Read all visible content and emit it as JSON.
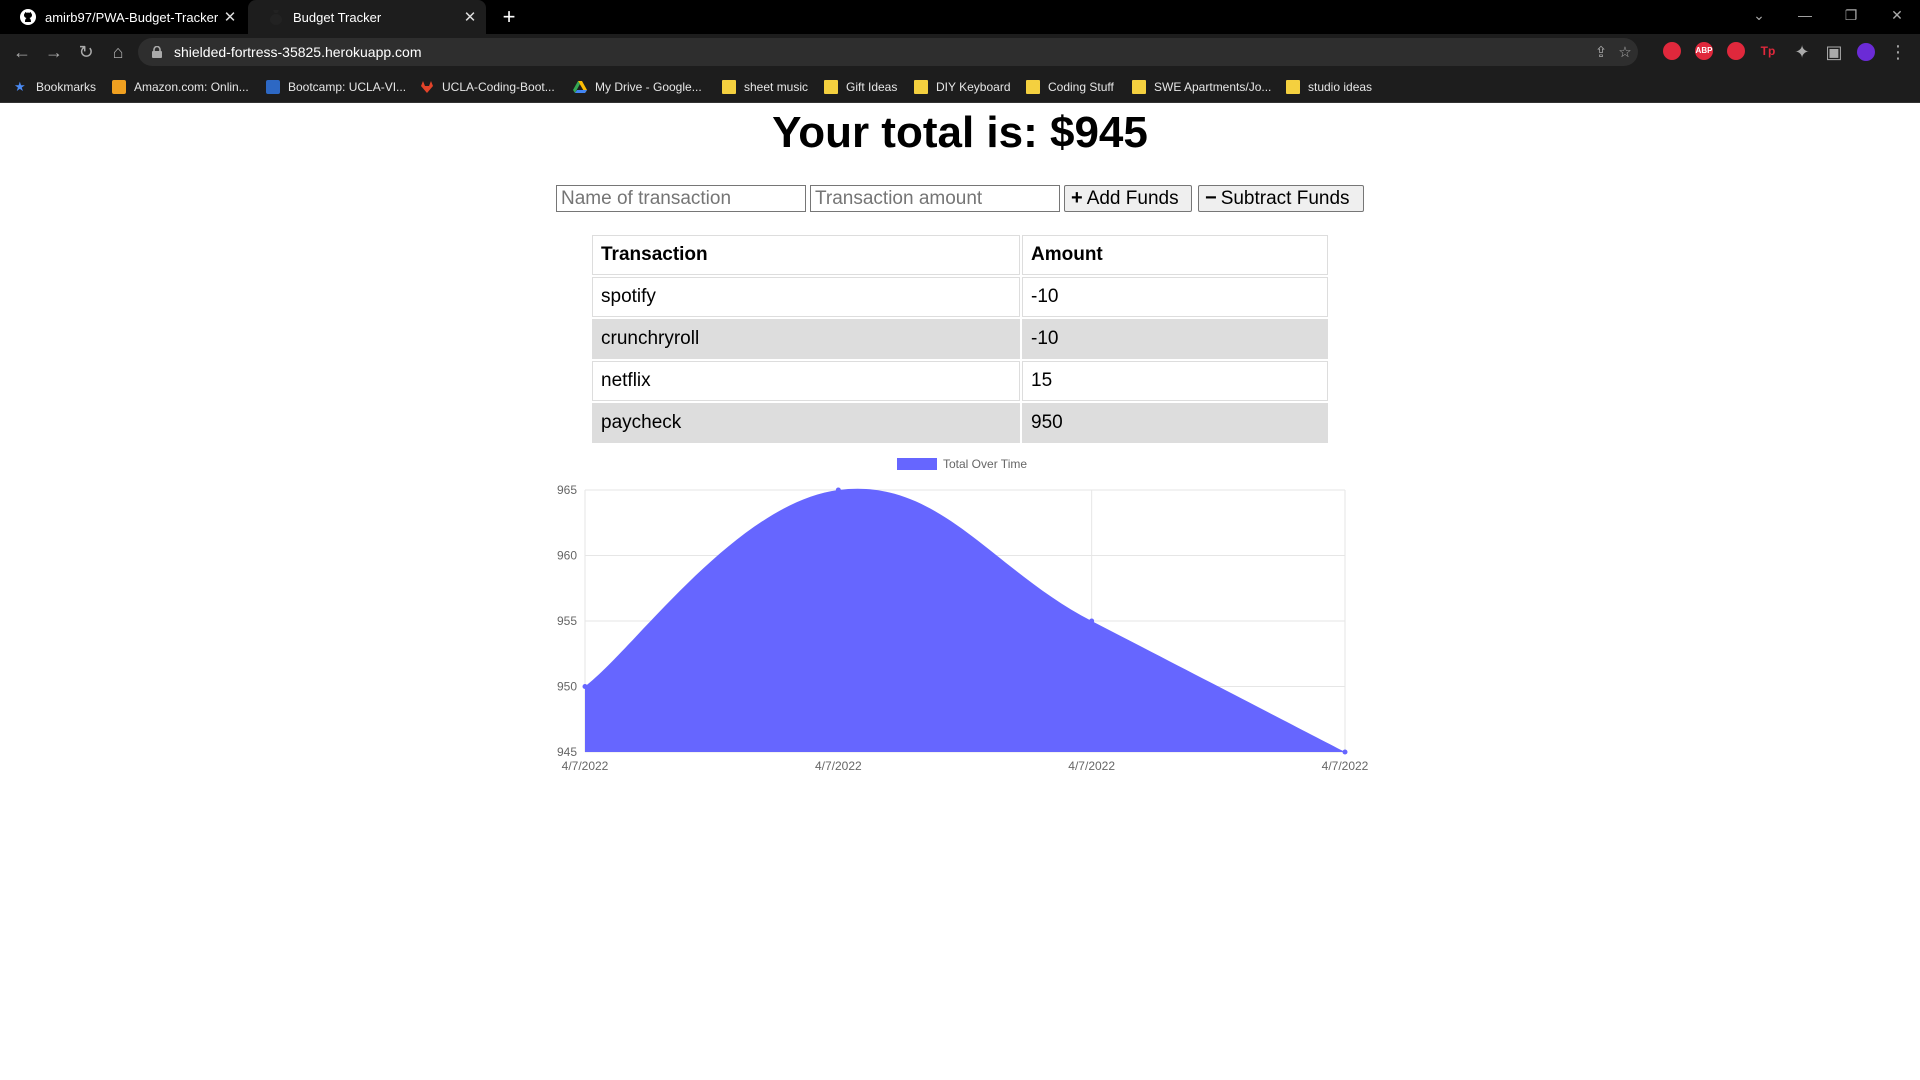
{
  "browser": {
    "tabs": [
      {
        "title": "amirb97/PWA-Budget-Tracker",
        "icon": "github-icon"
      },
      {
        "title": "Budget Tracker",
        "icon": "money-bag-icon"
      }
    ],
    "url": "shielded-fortress-35825.herokuapp.com",
    "bookmarks": [
      {
        "label": "Bookmarks",
        "icon": "star-icon"
      },
      {
        "label": "Amazon.com: Onlin...",
        "icon": "amazon-icon"
      },
      {
        "label": "Bootcamp: UCLA-VI...",
        "icon": "ucla-icon"
      },
      {
        "label": "UCLA-Coding-Boot...",
        "icon": "gitlab-icon"
      },
      {
        "label": "My Drive - Google...",
        "icon": "google-drive-icon"
      },
      {
        "label": "sheet music",
        "icon": "folder-icon"
      },
      {
        "label": "Gift Ideas",
        "icon": "folder-icon"
      },
      {
        "label": "DIY Keyboard",
        "icon": "folder-icon"
      },
      {
        "label": "Coding Stuff",
        "icon": "folder-icon"
      },
      {
        "label": "SWE Apartments/Jo...",
        "icon": "folder-icon"
      },
      {
        "label": "studio ideas",
        "icon": "folder-icon"
      }
    ],
    "extensions": [
      {
        "label": "",
        "color": "#e0283c"
      },
      {
        "label": "ABP",
        "color": "#e0283c"
      },
      {
        "label": "",
        "color": "#e0283c"
      },
      {
        "label": "Tp",
        "color": "#e0283c"
      }
    ]
  },
  "app": {
    "total_text": "Your total is: $945",
    "name_placeholder": "Name of transaction",
    "amount_placeholder": "Transaction amount",
    "add_label": "Add Funds",
    "subtract_label": "Subtract Funds",
    "table": {
      "headers": [
        "Transaction",
        "Amount"
      ],
      "rows": [
        {
          "name": "spotify",
          "amount": "-10"
        },
        {
          "name": "crunchryroll",
          "amount": "-10"
        },
        {
          "name": "netflix",
          "amount": "15"
        },
        {
          "name": "paycheck",
          "amount": "950"
        }
      ]
    }
  },
  "chart_data": {
    "type": "area",
    "categories": [
      "4/7/2022",
      "4/7/2022",
      "4/7/2022",
      "4/7/2022"
    ],
    "series": [
      {
        "name": "Total Over Time",
        "values": [
          950,
          965,
          955,
          945
        ],
        "color": "#6666ff"
      }
    ],
    "yticks": [
      945,
      950,
      955,
      960,
      965
    ],
    "ylim": [
      945,
      965
    ],
    "legend": "top-center",
    "grid": true
  }
}
